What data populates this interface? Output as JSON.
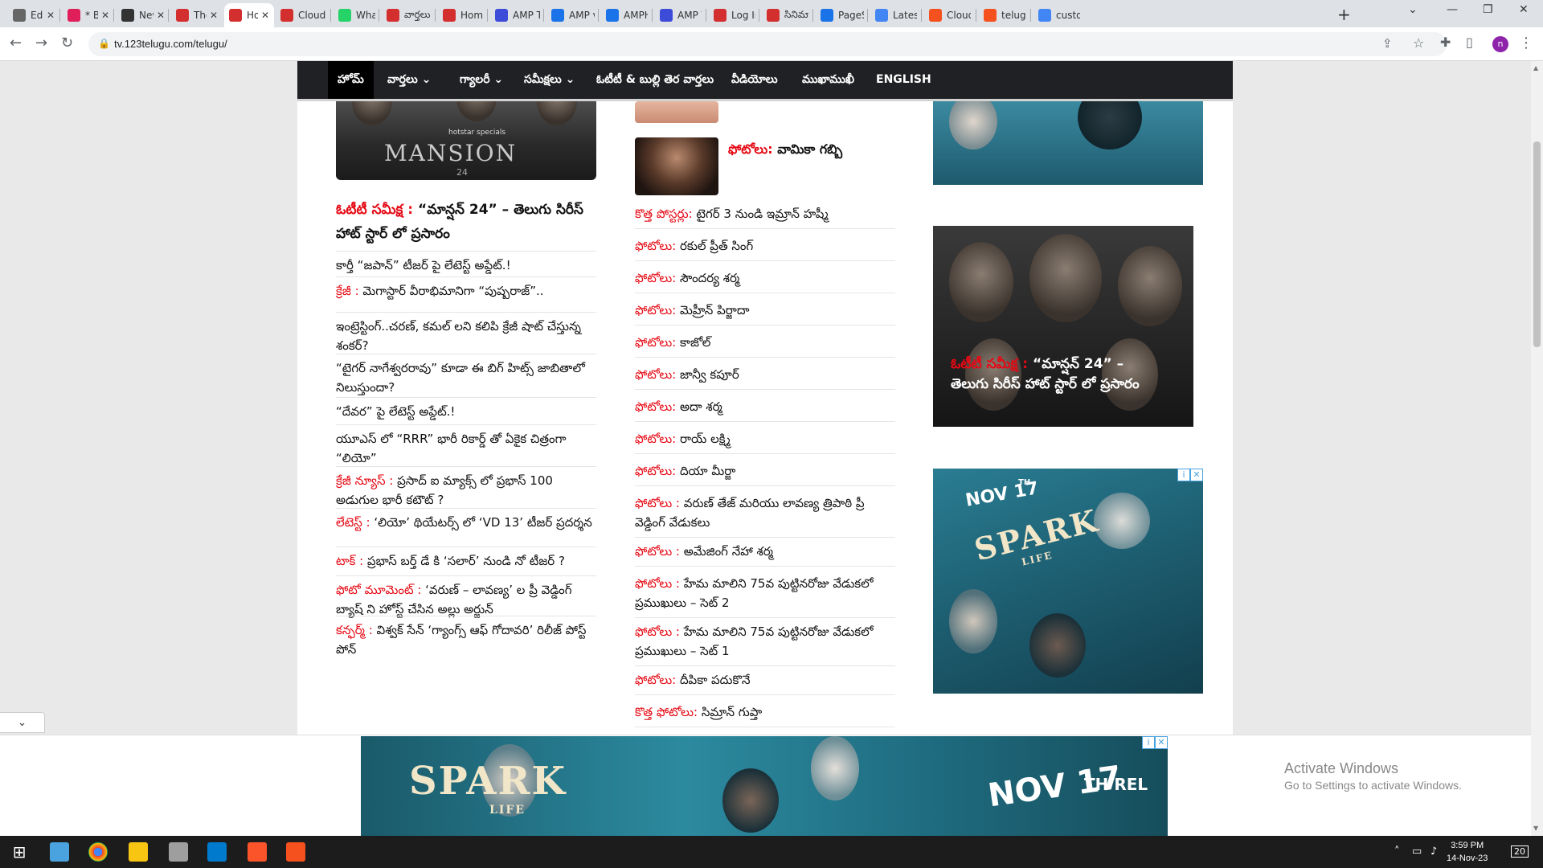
{
  "browser": {
    "tabs": [
      {
        "label": "Edi",
        "color": "#666"
      },
      {
        "label": "* B",
        "color": "#e01e5a"
      },
      {
        "label": "Newspa",
        "color": "#333"
      },
      {
        "label": "Theme",
        "color": "#d32f2f"
      },
      {
        "label": "Ho",
        "color": "#d32f2f"
      },
      {
        "label": "Cloud t",
        "color": "#d32f2f"
      },
      {
        "label": "WhatsA",
        "color": "#25d366"
      },
      {
        "label": "వార్తలు",
        "color": "#d32f2f"
      },
      {
        "label": "Home |",
        "color": "#d32f2f"
      },
      {
        "label": "AMP Te",
        "color": "#3c4cd9"
      },
      {
        "label": "AMP va",
        "color": "#1a73e8"
      },
      {
        "label": "AMPHT",
        "color": "#1a73e8"
      },
      {
        "label": "AMP Te",
        "color": "#3c4cd9"
      },
      {
        "label": "Log In",
        "color": "#d32f2f"
      },
      {
        "label": "సినిమా",
        "color": "#d32f2f"
      },
      {
        "label": "PageSp",
        "color": "#1a73e8"
      },
      {
        "label": "Latest P",
        "color": "#4285f4"
      },
      {
        "label": "Cloud t",
        "color": "#f4511e"
      },
      {
        "label": "telugu_",
        "color": "#f4511e"
      },
      {
        "label": "custom",
        "color": "#4285f4"
      }
    ],
    "url": "tv.123telugu.com/telugu/",
    "profile_initial": "n"
  },
  "nav": {
    "items": [
      "హోమ్",
      "వార్తలు ⌄",
      "గ్యాలరీ ⌄",
      "సమీక్షలు ⌄",
      "ఓటీటీ & బుల్లి తెర వార్తలు",
      "వీడియోలు",
      "ముఖాముఖీ",
      "ENGLISH"
    ]
  },
  "left": {
    "thumb_title": "MANSION",
    "thumb_brand": "hotstar specials",
    "thumb_number": "24",
    "lead_tag": "ఓటీటీ సమీక్ష :",
    "lead_text": " “మాన్షన్ 24” – తెలుగు సిరీస్ హాట్ స్టార్ లో ప్రసారం",
    "items": [
      {
        "tag": "",
        "text": "కార్తీ “జపాన్” టీజర్ పై లేటెస్ట్ అప్డేట్.!"
      },
      {
        "tag": "క్రేజీ :",
        "text": " మెగాస్టార్ వీరాభిమానిగా “పుష్పరాజ్”.."
      },
      {
        "tag": "",
        "text": "ఇంట్రెస్టింగ్..చరణ్, కమల్ లని కలిపి క్రేజీ షాట్ చేస్తున్న శంకర్?"
      },
      {
        "tag": "",
        "text": "“టైగర్ నాగేశ్వరరావు” కూడా ఈ బిగ్ హిట్స్ జాబితాలో నిలుస్తుందా?"
      },
      {
        "tag": "",
        "text": "“దేవర” పై లేటెస్ట్ అప్డేట్.!"
      },
      {
        "tag": "",
        "text": "యూఎస్ లో “RRR” భారీ రికార్డ్ తో ఏకైక చిత్రంగా “లియో”"
      },
      {
        "tag": "క్రేజీ న్యూస్ :",
        "text": " ప్రసాద్ ఐ మ్యాక్స్ లో ప్రభాస్ 100 అడుగుల భారీ కటౌట్ ?"
      },
      {
        "tag": "లేటెస్ట్ :",
        "text": " ‘లియో’ థియేటర్స్ లో ‘VD 13’ టీజర్ ప్రదర్శన"
      },
      {
        "tag": "టాక్ :",
        "text": " ప్రభాస్ బర్త్ డే కి ‘సలార్’ నుండి నో టీజర్ ?"
      },
      {
        "tag": "ఫోటో మూమెంట్ :",
        "text": " ‘వరుణ్ – లావణ్య’ ల ప్రీ వెడ్డింగ్ బ్యాష్ ని హోస్ట్ చేసిన అల్లు అర్జున్"
      },
      {
        "tag": "కన్ఫర్మ్ :",
        "text": " విశ్వక్ సేన్ ‘గ్యాంగ్స్ ఆఫ్ గోదావరి’ రిలీజ్ పోస్ట్ పోన్"
      }
    ]
  },
  "middle": {
    "feature_tag": "ఫోటోలు:",
    "feature_text": " వామికా గబ్బి",
    "items": [
      {
        "tag": "కొత్త పోస్టర్లు:",
        "text": " టైగర్ 3 నుండి ఇమ్రాన్ హష్మీ"
      },
      {
        "tag": "ఫోటోలు:",
        "text": " రకుల్ ప్రీత్ సింగ్"
      },
      {
        "tag": "ఫోటోలు:",
        "text": " సౌందర్య శర్మ"
      },
      {
        "tag": "ఫోటోలు:",
        "text": " మెహ్రీన్ పిర్జాదా"
      },
      {
        "tag": "ఫోటోలు:",
        "text": " కాజోల్"
      },
      {
        "tag": "ఫోటోలు:",
        "text": " జాన్వీ కపూర్"
      },
      {
        "tag": "ఫోటోలు:",
        "text": " అదా శర్మ"
      },
      {
        "tag": "ఫోటోలు:",
        "text": " రాయ్ లక్ష్మి"
      },
      {
        "tag": "ఫోటోలు:",
        "text": " దియా మీర్జా"
      },
      {
        "tag": "ఫోటోలు :",
        "text": " వరుణ్ తేజ్ మరియు లావణ్య త్రిపాఠి ప్రీ వెడ్డింగ్ వేడుకలు"
      },
      {
        "tag": "ఫోటోలు :",
        "text": " అమేజింగ్ నేహా శర్మ"
      },
      {
        "tag": "ఫోటోలు :",
        "text": " హేమ మాలిని 75వ పుట్టినరోజు వేడుకలో ప్రముఖులు – సెట్ 2"
      },
      {
        "tag": "ఫోటోలు :",
        "text": " హేమ మాలిని 75వ పుట్టినరోజు వేడుకలో ప్రముఖులు – సెట్ 1"
      },
      {
        "tag": "ఫోటోలు:",
        "text": " దీపికా పదుకొనే"
      },
      {
        "tag": "కొత్త ఫోటోలు:",
        "text": " సిమ్రాన్ గుప్తా"
      }
    ]
  },
  "right": {
    "poster_tag": "ఓటీటీ సమీక్ష :",
    "poster_text": " “మాన్షన్ 24” – తెలుగు సిరీస్ హాట్ స్టార్ లో ప్రసారం",
    "ad_title": "SPARK",
    "ad_sub": "LIFE",
    "ad_date": "NOV 17",
    "ad_suffix": "TH"
  },
  "banner": {
    "title": "SPARK",
    "sub": "LIFE",
    "date": "NOV 17",
    "suffix": "TH REL"
  },
  "watermark": {
    "line1": "Activate Windows",
    "line2": "Go to Settings to activate Windows."
  },
  "taskbar": {
    "time": "3:59 PM",
    "date": "14-Nov-23",
    "notifications": "20"
  }
}
